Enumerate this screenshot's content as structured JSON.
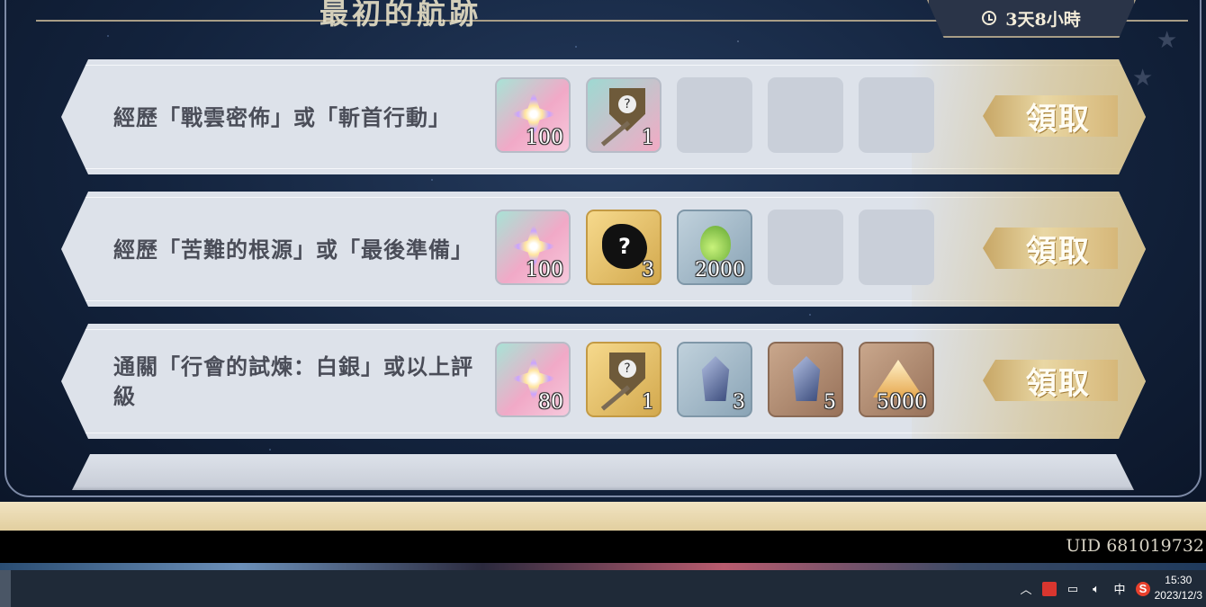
{
  "header": {
    "title": "最初的航跡",
    "timer": "3天8小時"
  },
  "tasks": [
    {
      "text": "經歷「戰雲密佈」或「斬首行動」",
      "rewards": [
        {
          "icon": "star-gem-icon",
          "qty": "100"
        },
        {
          "icon": "shield-sword-icon",
          "qty": "1"
        },
        null,
        null,
        null
      ],
      "claim_label": "領取"
    },
    {
      "text": "經歷「苦難的根源」或「最後準備」",
      "rewards": [
        {
          "icon": "star-gem-icon",
          "qty": "100"
        },
        {
          "icon": "mystery-blob-icon",
          "qty": "3"
        },
        {
          "icon": "potion-icon",
          "qty": "2000"
        },
        null,
        null
      ],
      "claim_label": "領取"
    },
    {
      "text": "通關「行會的試煉：白銀」或以上評級",
      "rewards": [
        {
          "icon": "star-gem-icon",
          "qty": "80"
        },
        {
          "icon": "shield-sword-icon",
          "qty": "1"
        },
        {
          "icon": "crystal-icon",
          "qty": "3"
        },
        {
          "icon": "crystal-icon",
          "qty": "5"
        },
        {
          "icon": "gold-pile-icon",
          "qty": "5000"
        }
      ],
      "claim_label": "領取"
    }
  ],
  "footer": {
    "uid": "UID 681019732"
  },
  "taskbar": {
    "ime": "中",
    "time": "15:30",
    "date": "2023/12/3"
  }
}
